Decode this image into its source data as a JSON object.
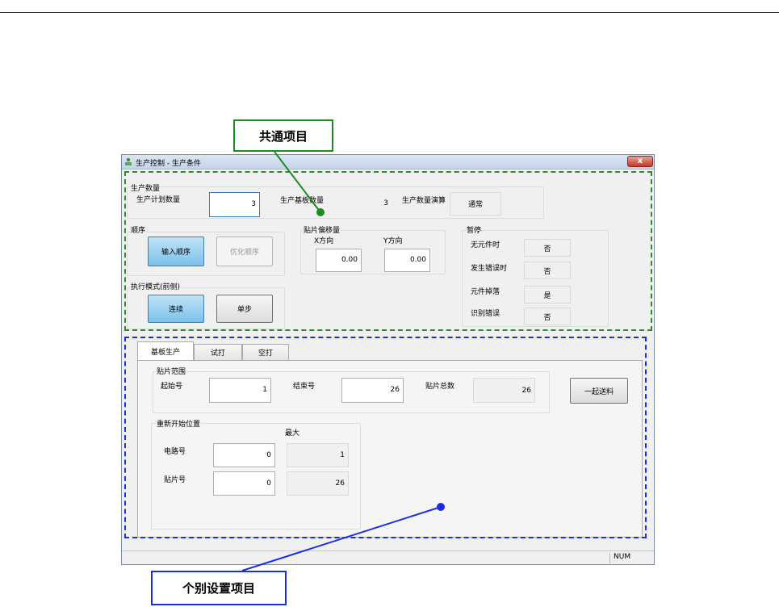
{
  "annotations": {
    "common_label": "共通项目",
    "individual_label": "个别设置项目",
    "common_color": "#1f8a1f",
    "individual_color": "#1a2ee0"
  },
  "window": {
    "title": "生产控制 - 生产条件",
    "close_label": "x",
    "icon": "app-icon"
  },
  "production_count": {
    "group_label": "生产数量",
    "planned_label": "生产计划数量",
    "planned_value": "3",
    "board_count_label": "生产基板数量",
    "board_count_value": "3",
    "calc_label": "生产数量演算",
    "calc_value": "通常"
  },
  "order": {
    "group_label": "顺序",
    "input_order": "输入顺序",
    "optimize_order": "优化顺序"
  },
  "offset": {
    "group_label": "贴片偏移量",
    "x_label": "X方向",
    "x_value": "0.00",
    "y_label": "Y方向",
    "y_value": "0.00"
  },
  "pause": {
    "group_label": "暂停",
    "rows": [
      {
        "label": "无元件时",
        "value": "否"
      },
      {
        "label": "发生错误时",
        "value": "否"
      },
      {
        "label": "元件掉落",
        "value": "是"
      },
      {
        "label": "识别错误",
        "value": "否"
      }
    ]
  },
  "exec_mode": {
    "group_label": "执行模式(前侧)",
    "continuous": "连续",
    "step": "单步"
  },
  "tabs": [
    "基板生产",
    "试打",
    "空打"
  ],
  "placement_range": {
    "group_label": "贴片范围",
    "start_label": "起始号",
    "start_value": "1",
    "end_label": "结束号",
    "end_value": "26",
    "total_label": "贴片总数",
    "total_value": "26",
    "feed_button": "一起送料"
  },
  "restart": {
    "group_label": "重新开始位置",
    "max_label": "最大",
    "circuit_label": "电路号",
    "circuit_value": "0",
    "circuit_max": "1",
    "placement_label": "贴片号",
    "placement_value": "0",
    "placement_max": "26"
  },
  "statusbar": {
    "num": "NUM"
  }
}
